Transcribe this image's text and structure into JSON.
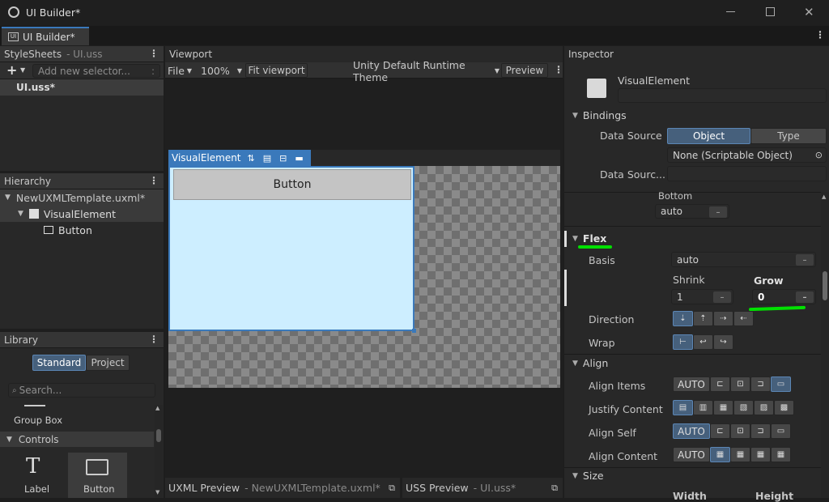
{
  "window": {
    "title": "UI Builder*"
  },
  "tab": {
    "label": "UI Builder*"
  },
  "stylesheets": {
    "title": "StyleSheets",
    "file": "- UI.uss",
    "add_placeholder": "Add new selector...",
    "item": "UI.uss*"
  },
  "hierarchy": {
    "title": "Hierarchy",
    "items": [
      "NewUXMLTemplate.uxml*",
      "VisualElement",
      "Button"
    ]
  },
  "library": {
    "title": "Library",
    "tabs": [
      "Standard",
      "Project"
    ],
    "search_placeholder": "Search...",
    "group_box": "Group Box",
    "controls": "Controls",
    "tiles": [
      "Label",
      "Button"
    ]
  },
  "viewport": {
    "title": "Viewport",
    "toolbar": {
      "file": "File",
      "zoom": "100%",
      "fit": "Fit viewport",
      "theme": "Unity Default Runtime Theme",
      "preview": "Preview"
    },
    "element_label": "VisualElement",
    "button_text": "Button",
    "uxml_preview": "UXML Preview",
    "uxml_file": "- NewUXMLTemplate.uxml*",
    "uss_preview": "USS Preview",
    "uss_file": "- UI.uss*"
  },
  "inspector": {
    "title": "Inspector",
    "element_name": "VisualElement",
    "bindings": {
      "title": "Bindings",
      "data_source": "Data Source",
      "options": [
        "Object",
        "Type"
      ],
      "value": "None (Scriptable Object)",
      "data_source_path": "Data Sourc..."
    },
    "bottom": {
      "label": "Bottom",
      "value": "auto"
    },
    "flex": {
      "title": "Flex",
      "basis_label": "Basis",
      "basis_value": "auto",
      "shrink_label": "Shrink",
      "shrink_value": "1",
      "grow_label": "Grow",
      "grow_value": "0",
      "direction_label": "Direction",
      "wrap_label": "Wrap"
    },
    "align": {
      "title": "Align",
      "items_label": "Align Items",
      "justify_label": "Justify Content",
      "self_label": "Align Self",
      "content_label": "Align Content",
      "auto": "AUTO"
    },
    "size": {
      "title": "Size",
      "width": "Width",
      "height": "Height"
    }
  },
  "colors": {
    "accent": "#3a79bb",
    "highlight": "#00e000",
    "canvas": "#cdeeff"
  }
}
